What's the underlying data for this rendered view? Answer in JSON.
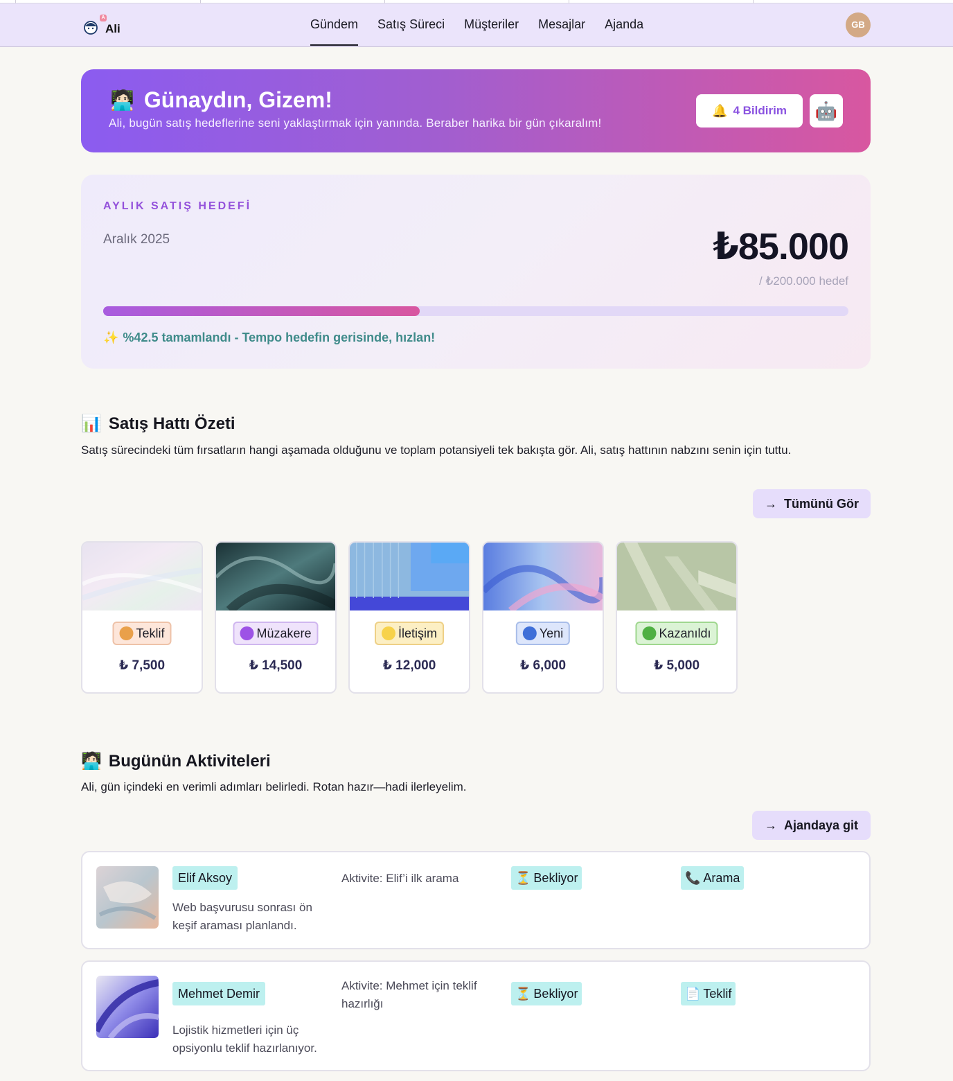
{
  "nav": {
    "logo_text": "Ali",
    "logo_badge": "A",
    "links": [
      "Gündem",
      "Satış Süreci",
      "Müşteriler",
      "Mesajlar",
      "Ajanda"
    ],
    "active": "Gündem",
    "avatar": "GB"
  },
  "greeting": {
    "emoji": "🧑🏻‍💻",
    "title": "Günaydın, Gizem!",
    "subtitle": "Ali, bugün satış hedeflerine seni yaklaştırmak için yanında. Beraber harika bir gün çıkaralım!",
    "notifications_icon": "bell-icon",
    "notifications_label": "4 Bildirim",
    "bot_icon": "robot-icon"
  },
  "goal": {
    "label": "AYLIK SATIŞ HEDEFİ",
    "period": "Aralık 2025",
    "amount": "₺85.000",
    "target": "/ ₺200.000 hedef",
    "progress_percent": 42.5,
    "status": "%42.5 tamamlandı - Tempo hedefin gerisinde, hızlan!"
  },
  "pipeline": {
    "emoji": "📊",
    "title": "Satış Hattı Özeti",
    "description": "Satış sürecindeki tüm fırsatların hangi aşamada olduğunu ve toplam potansiyeli tek bakışta gör. Ali, satış hattının nabzını senin için tuttu.",
    "button": "Tümünü Gör",
    "stages": [
      {
        "label": "Teklif",
        "value": "₺ 7,500",
        "dot": "#e9a04a",
        "bg": "#fde6da",
        "border": "#eec2a8"
      },
      {
        "label": "Müzakere",
        "value": "₺ 14,500",
        "dot": "#9d52e6",
        "bg": "#efe3fb",
        "border": "#cfb6ef"
      },
      {
        "label": "İletişim",
        "value": "₺ 12,000",
        "dot": "#f7d24a",
        "bg": "#fcefc4",
        "border": "#eed086"
      },
      {
        "label": "Yeni",
        "value": "₺ 6,000",
        "dot": "#3f6fd8",
        "bg": "#dde6fb",
        "border": "#a8bde9"
      },
      {
        "label": "Kazanıldı",
        "value": "₺ 5,000",
        "dot": "#4fb043",
        "bg": "#dbf3d5",
        "border": "#9fd78e"
      }
    ]
  },
  "activities": {
    "emoji": "🧑🏻‍💻",
    "title": "Bugünün Aktiviteleri",
    "description": "Ali, gün içindeki en verimli adımları belirledi. Rotan hazır—hadi ilerleyelim.",
    "button": "Ajandaya git",
    "items": [
      {
        "name": "Elif Aksoy",
        "description": "Web başvurusu sonrası ön keşif araması planlandı.",
        "activity": "Aktivite: Elif’i ilk arama",
        "status_icon": "⏳",
        "status": "Bekliyor",
        "type_icon": "📞",
        "type": "Arama"
      },
      {
        "name": "Mehmet Demir",
        "description": "Lojistik hizmetleri için üç opsiyonlu teklif hazırlanıyor.",
        "activity": "Aktivite: Mehmet için teklif hazırlığı",
        "status_icon": "⏳",
        "status": "Bekliyor",
        "type_icon": "📄",
        "type": "Teklif"
      }
    ]
  }
}
